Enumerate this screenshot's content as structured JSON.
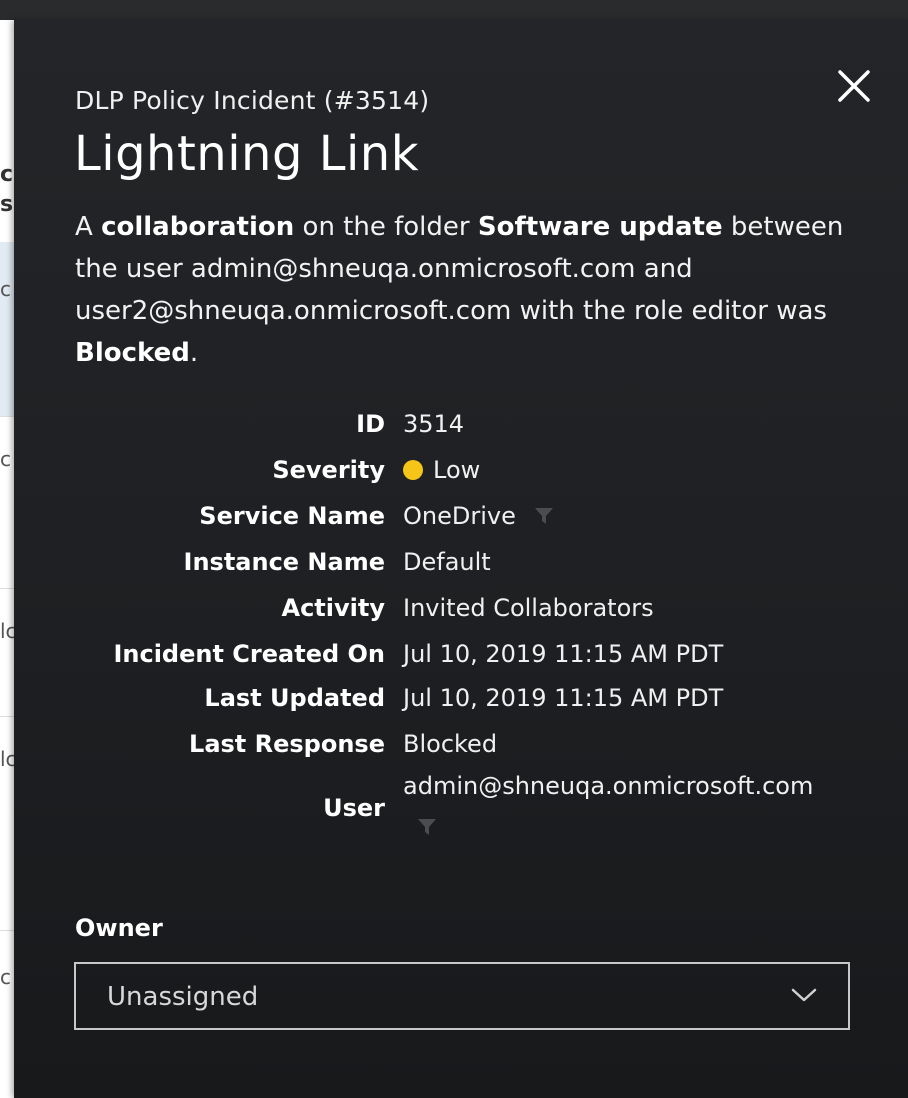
{
  "background": {
    "fragments": [
      "ci",
      "s",
      "c",
      "c",
      "lc",
      "lc",
      "c"
    ]
  },
  "panel": {
    "close_icon": "close-icon",
    "subtitle": "DLP Policy Incident (#3514)",
    "title": "Lightning Link",
    "description": {
      "p1": "A ",
      "b1": "collaboration",
      "p2": " on the folder ",
      "b2": "Software update",
      "p3": " between the user admin@shneuqa.onmicrosoft.com and user2@shneuqa.onmicrosoft.com with the role editor was ",
      "b3": "Blocked",
      "p4": "."
    },
    "details": {
      "id": {
        "label": "ID",
        "value": "3514"
      },
      "severity": {
        "label": "Severity",
        "value": "Low",
        "color": "#f5c518"
      },
      "service_name": {
        "label": "Service Name",
        "value": "OneDrive"
      },
      "instance_name": {
        "label": "Instance Name",
        "value": "Default"
      },
      "activity": {
        "label": "Activity",
        "value": "Invited Collaborators"
      },
      "created_on": {
        "label": "Incident Created On",
        "value": "Jul 10, 2019 11:15 AM PDT"
      },
      "last_updated": {
        "label": "Last Updated",
        "value": "Jul 10, 2019 11:15 AM PDT"
      },
      "last_response": {
        "label": "Last Response",
        "value": "Blocked"
      },
      "user": {
        "label": "User",
        "value": "admin@shneuqa.onmicrosoft.com"
      }
    },
    "owner": {
      "label": "Owner",
      "selected": "Unassigned"
    }
  },
  "colors": {
    "panel_bg": "#1e2023",
    "severity_low": "#f5c518",
    "text": "#ffffff"
  }
}
